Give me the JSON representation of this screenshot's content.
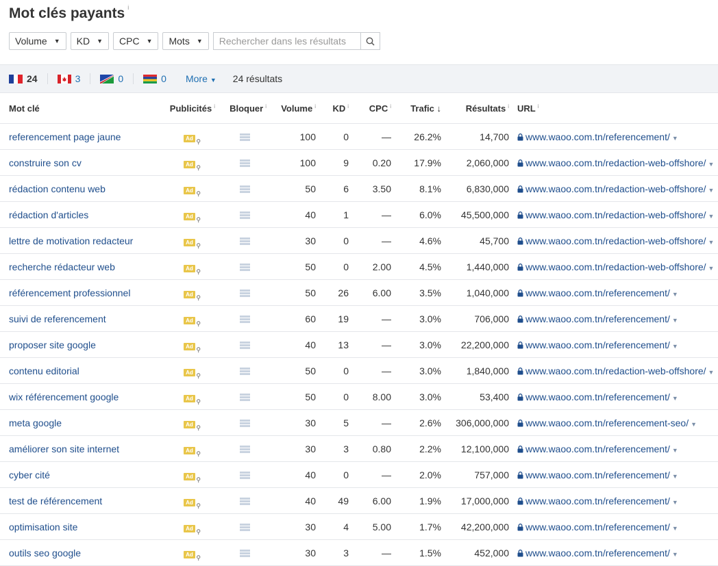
{
  "page": {
    "title": "Mot clés payants",
    "title_info": "i"
  },
  "filters": {
    "volume": "Volume",
    "kd": "KD",
    "cpc": "CPC",
    "mots": "Mots",
    "search_placeholder": "Rechercher dans les résultats"
  },
  "countries": [
    {
      "code": "FR",
      "count": "24"
    },
    {
      "code": "CA",
      "count": "3"
    },
    {
      "code": "NA",
      "count": "0"
    },
    {
      "code": "MU",
      "count": "0"
    }
  ],
  "more_label": "More",
  "results_label": "24 résultats",
  "columns": {
    "keyword": "Mot clé",
    "ads": "Publicités",
    "block": "Bloquer",
    "volume": "Volume",
    "kd": "KD",
    "cpc": "CPC",
    "traffic": "Trafic",
    "results": "Résultats",
    "url": "URL",
    "info": "i",
    "sort_arrow": "↓"
  },
  "ad_badge": "Ad",
  "rows": [
    {
      "keyword": "referencement page jaune",
      "volume": "100",
      "kd": "0",
      "cpc": "—",
      "traffic": "26.2%",
      "results": "14,700",
      "url": "www.waoo.com.tn/referencement/"
    },
    {
      "keyword": "construire son cv",
      "volume": "100",
      "kd": "9",
      "cpc": "0.20",
      "traffic": "17.9%",
      "results": "2,060,000",
      "url": "www.waoo.com.tn/redaction-web-offshore/"
    },
    {
      "keyword": "rédaction contenu web",
      "volume": "50",
      "kd": "6",
      "cpc": "3.50",
      "traffic": "8.1%",
      "results": "6,830,000",
      "url": "www.waoo.com.tn/redaction-web-offshore/"
    },
    {
      "keyword": "rédaction d'articles",
      "volume": "40",
      "kd": "1",
      "cpc": "—",
      "traffic": "6.0%",
      "results": "45,500,000",
      "url": "www.waoo.com.tn/redaction-web-offshore/"
    },
    {
      "keyword": "lettre de motivation redacteur",
      "volume": "30",
      "kd": "0",
      "cpc": "—",
      "traffic": "4.6%",
      "results": "45,700",
      "url": "www.waoo.com.tn/redaction-web-offshore/"
    },
    {
      "keyword": "recherche rédacteur web",
      "volume": "50",
      "kd": "0",
      "cpc": "2.00",
      "traffic": "4.5%",
      "results": "1,440,000",
      "url": "www.waoo.com.tn/redaction-web-offshore/"
    },
    {
      "keyword": "référencement professionnel",
      "volume": "50",
      "kd": "26",
      "cpc": "6.00",
      "traffic": "3.5%",
      "results": "1,040,000",
      "url": "www.waoo.com.tn/referencement/"
    },
    {
      "keyword": "suivi de referencement",
      "volume": "60",
      "kd": "19",
      "cpc": "—",
      "traffic": "3.0%",
      "results": "706,000",
      "url": "www.waoo.com.tn/referencement/"
    },
    {
      "keyword": "proposer site google",
      "volume": "40",
      "kd": "13",
      "cpc": "—",
      "traffic": "3.0%",
      "results": "22,200,000",
      "url": "www.waoo.com.tn/referencement/"
    },
    {
      "keyword": "contenu editorial",
      "volume": "50",
      "kd": "0",
      "cpc": "—",
      "traffic": "3.0%",
      "results": "1,840,000",
      "url": "www.waoo.com.tn/redaction-web-offshore/"
    },
    {
      "keyword": "wix référencement google",
      "volume": "50",
      "kd": "0",
      "cpc": "8.00",
      "traffic": "3.0%",
      "results": "53,400",
      "url": "www.waoo.com.tn/referencement/"
    },
    {
      "keyword": "meta google",
      "volume": "30",
      "kd": "5",
      "cpc": "—",
      "traffic": "2.6%",
      "results": "306,000,000",
      "url": "www.waoo.com.tn/referencement-seo/"
    },
    {
      "keyword": "améliorer son site internet",
      "volume": "30",
      "kd": "3",
      "cpc": "0.80",
      "traffic": "2.2%",
      "results": "12,100,000",
      "url": "www.waoo.com.tn/referencement/"
    },
    {
      "keyword": "cyber cité",
      "volume": "40",
      "kd": "0",
      "cpc": "—",
      "traffic": "2.0%",
      "results": "757,000",
      "url": "www.waoo.com.tn/referencement/"
    },
    {
      "keyword": "test de référencement",
      "volume": "40",
      "kd": "49",
      "cpc": "6.00",
      "traffic": "1.9%",
      "results": "17,000,000",
      "url": "www.waoo.com.tn/referencement/"
    },
    {
      "keyword": "optimisation site",
      "volume": "30",
      "kd": "4",
      "cpc": "5.00",
      "traffic": "1.7%",
      "results": "42,200,000",
      "url": "www.waoo.com.tn/referencement/"
    },
    {
      "keyword": "outils seo google",
      "volume": "30",
      "kd": "3",
      "cpc": "—",
      "traffic": "1.5%",
      "results": "452,000",
      "url": "www.waoo.com.tn/referencement/"
    }
  ]
}
